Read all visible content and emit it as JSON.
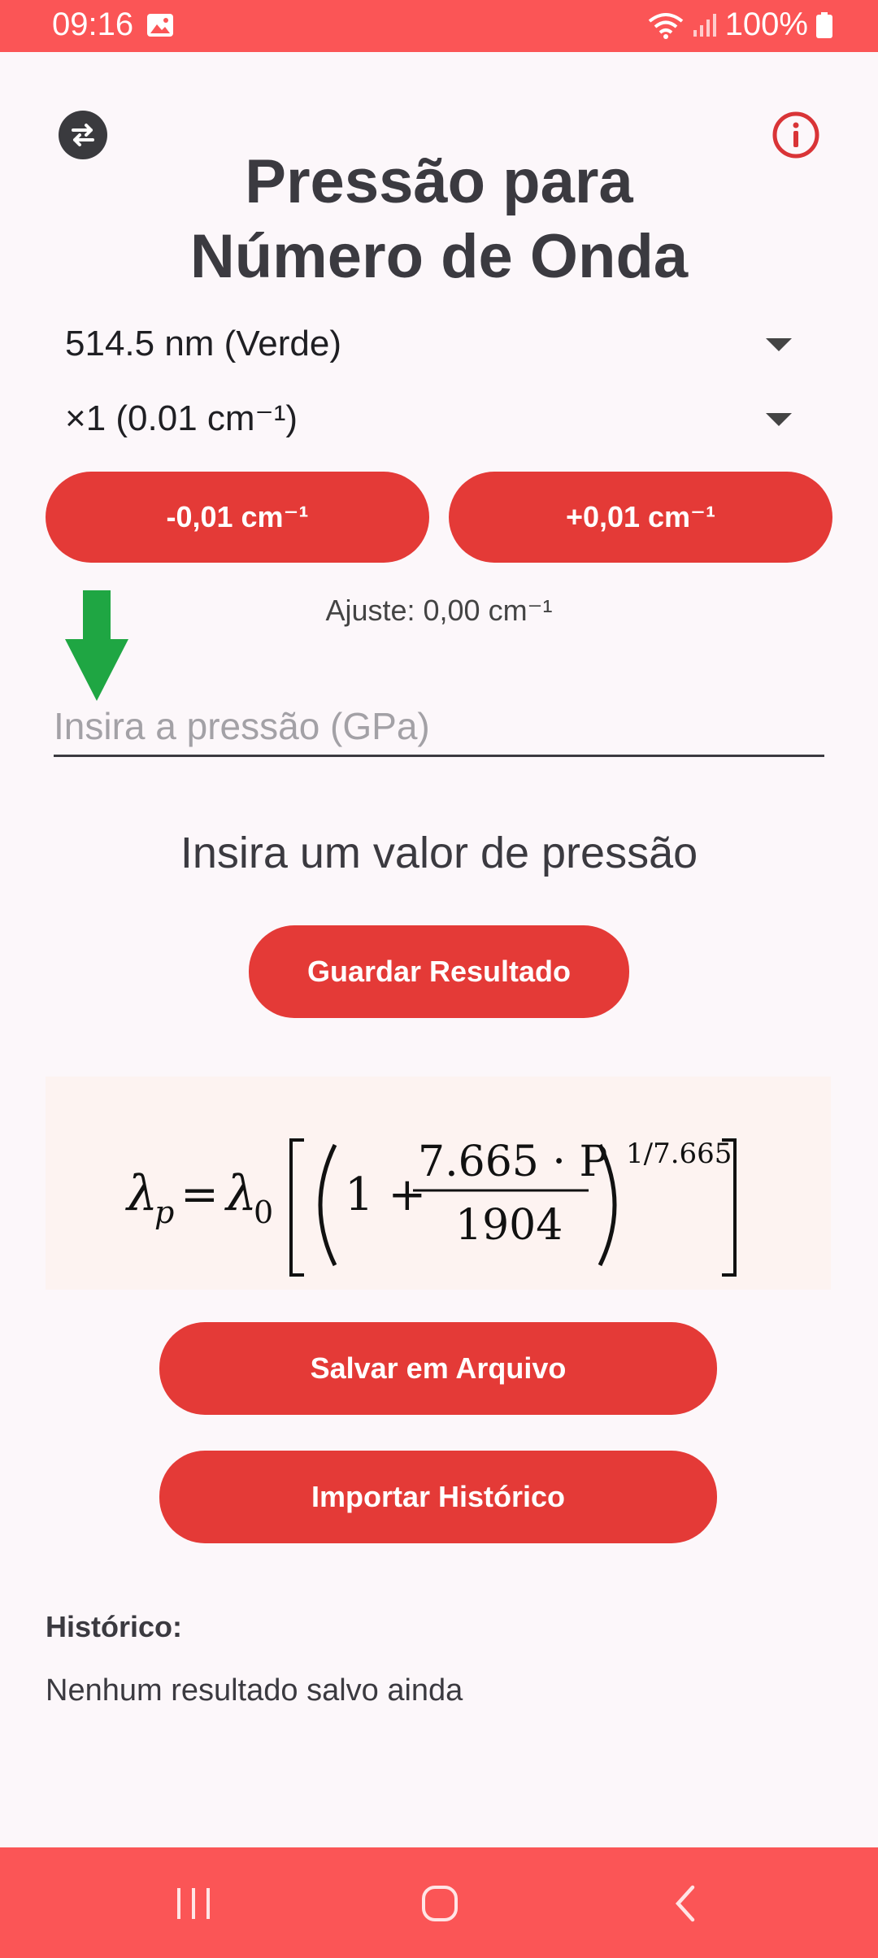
{
  "status_bar": {
    "time": "09:16",
    "battery": "100%"
  },
  "header": {
    "title_line1": "Pressão para",
    "title_line2": "Número de Onda"
  },
  "dropdowns": {
    "wavelength": "514.5 nm (Verde)",
    "step": "×1 (0.01 cm⁻¹)"
  },
  "adjust": {
    "minus_label": "-0,01 cm⁻¹",
    "plus_label": "+0,01 cm⁻¹",
    "value_text": "Ajuste: 0,00 cm⁻¹"
  },
  "pressure_input": {
    "placeholder": "Insira a pressão (GPa)",
    "value": ""
  },
  "prompt": "Insira um valor de pressão",
  "buttons": {
    "save_result": "Guardar Resultado",
    "save_file": "Salvar em Arquivo",
    "import_history": "Importar Histórico"
  },
  "formula": {
    "lhs": "λ",
    "lhs_sub": "p",
    "eq": "=",
    "lambda0": "λ",
    "lambda0_sub": "0",
    "one_plus": "1 +",
    "numerator": "7.665 · P",
    "denominator": "1904",
    "exponent": "1/7.665"
  },
  "history": {
    "title": "Histórico:",
    "empty_text": "Nenhum resultado salvo ainda"
  },
  "colors": {
    "accent": "#e43a37",
    "status_bar": "#fb5556",
    "arrow": "#1fa643",
    "info": "#d93437"
  }
}
